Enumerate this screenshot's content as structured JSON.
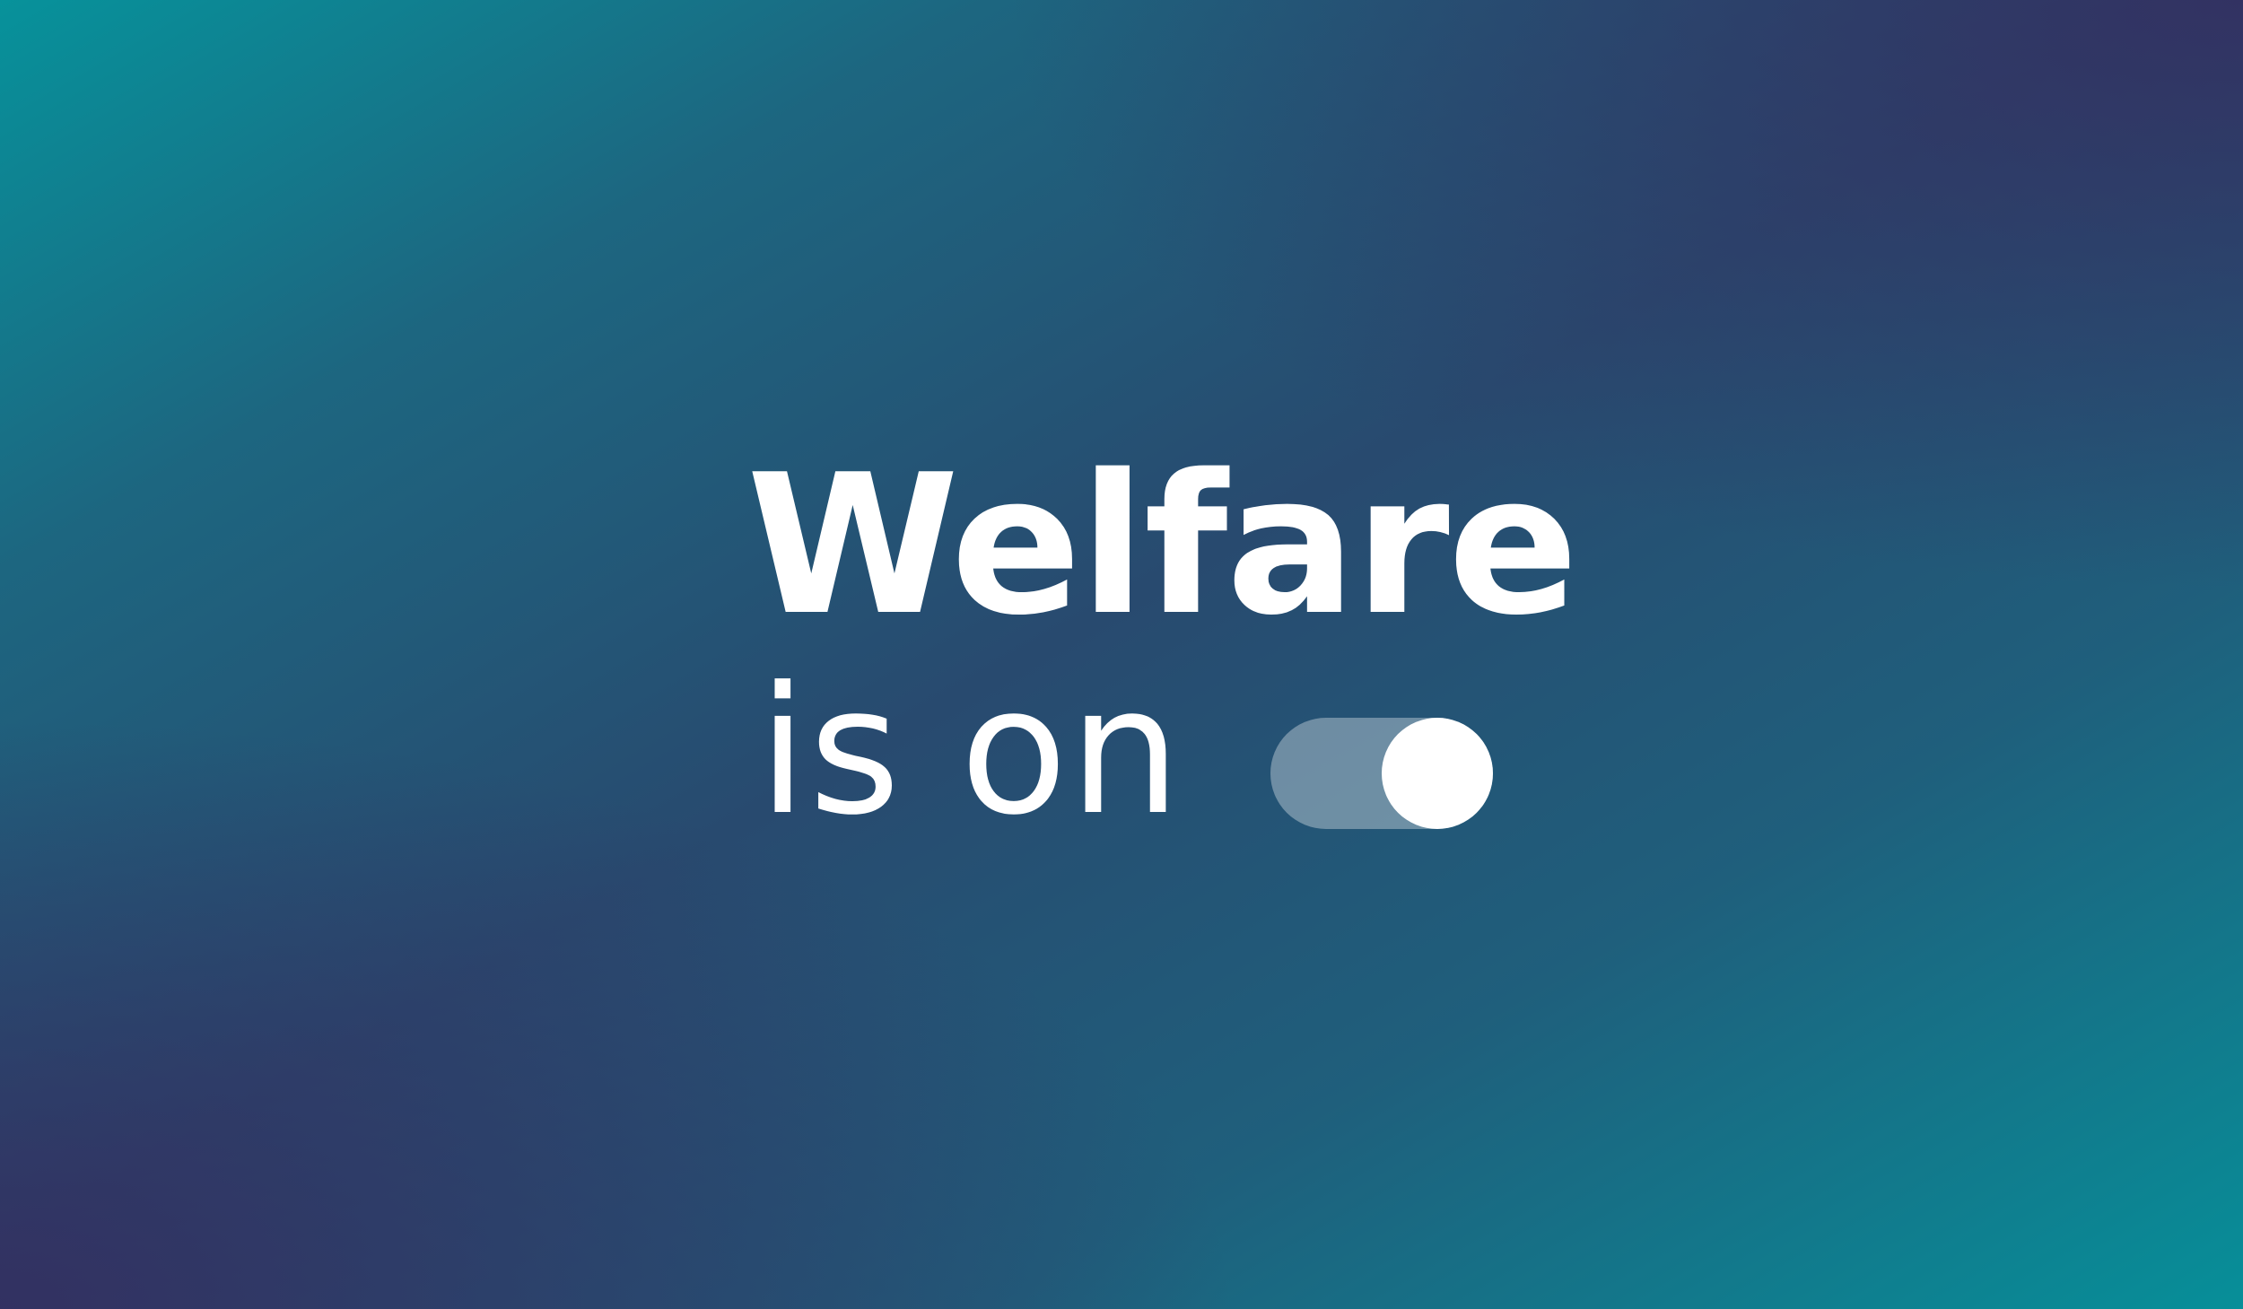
{
  "headline": {
    "title": "Welfare",
    "subtitle": "is on"
  },
  "toggle": {
    "state": "on",
    "colors": {
      "track": "rgba(255,255,255,0.34)",
      "knob": "#ffffff"
    }
  },
  "colors": {
    "text": "#ffffff",
    "background_teal": "#07929b",
    "background_indigo": "#342e60"
  }
}
